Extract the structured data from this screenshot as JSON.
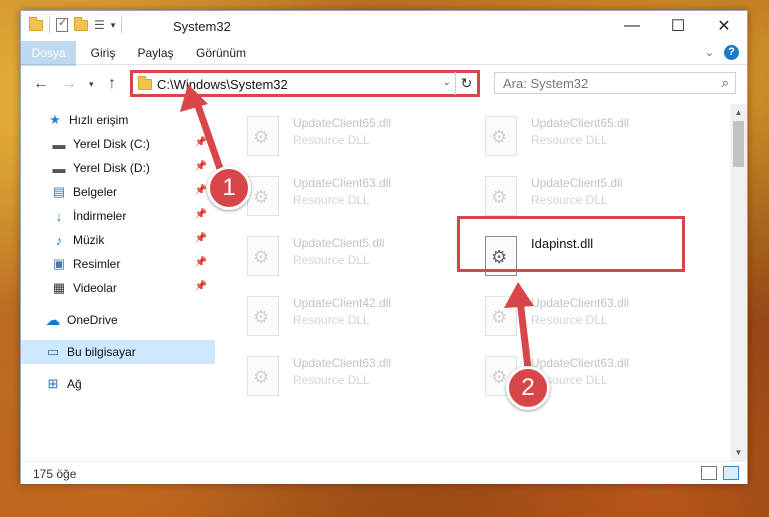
{
  "window": {
    "title": "System32",
    "controls": {
      "minimize": "—",
      "maximize": "☐",
      "close": "✕"
    }
  },
  "ribbon": {
    "tabs": [
      {
        "label": "Dosya"
      },
      {
        "label": "Giriş"
      },
      {
        "label": "Paylaş"
      },
      {
        "label": "Görünüm"
      }
    ],
    "help": "?"
  },
  "address": {
    "path": "C:\\Windows\\System32",
    "refresh": "↻"
  },
  "search": {
    "placeholder": "Ara: System32"
  },
  "nav": {
    "items": [
      {
        "label": "Hızlı erişim",
        "icon": "star-icon"
      },
      {
        "label": "Yerel Disk (C:)",
        "icon": "drive-icon",
        "pinned": true
      },
      {
        "label": "Yerel Disk (D:)",
        "icon": "drive-icon",
        "pinned": true
      },
      {
        "label": "Belgeler",
        "icon": "documents-icon",
        "pinned": true
      },
      {
        "label": "İndirmeler",
        "icon": "download-icon",
        "pinned": true
      },
      {
        "label": "Müzik",
        "icon": "music-icon",
        "pinned": true
      },
      {
        "label": "Resimler",
        "icon": "pictures-icon",
        "pinned": true
      },
      {
        "label": "Videolar",
        "icon": "videos-icon",
        "pinned": true
      },
      {
        "label": "OneDrive",
        "icon": "onedrive-icon"
      },
      {
        "label": "Bu bilgisayar",
        "icon": "computer-icon",
        "selected": true
      },
      {
        "label": "Ağ",
        "icon": "network-icon"
      }
    ]
  },
  "files": [
    {
      "name": "UpdateClient65.dll",
      "desc": "Resource DLL"
    },
    {
      "name": "UpdateClient65.dll",
      "desc": "Resource DLL"
    },
    {
      "name": "UpdateClient63.dll",
      "desc": "Resource DLL"
    },
    {
      "name": "UpdateClient5.dll",
      "desc": "Resource DLL"
    },
    {
      "name": "UpdateClient5.dll",
      "desc": "Resource DLL"
    },
    {
      "name": "Idapinst.dll",
      "desc": ""
    },
    {
      "name": "UpdateClient42.dll",
      "desc": "Resource DLL"
    },
    {
      "name": "UpdateClient63.dll",
      "desc": "Resource DLL"
    },
    {
      "name": "UpdateClient63.dll",
      "desc": "Resource DLL"
    },
    {
      "name": "UpdateClient63.dll",
      "desc": "Resource DLL"
    }
  ],
  "status": {
    "count": "175 öğe"
  },
  "annotations": {
    "step1": "1",
    "step2": "2",
    "color": "#d9464a"
  }
}
